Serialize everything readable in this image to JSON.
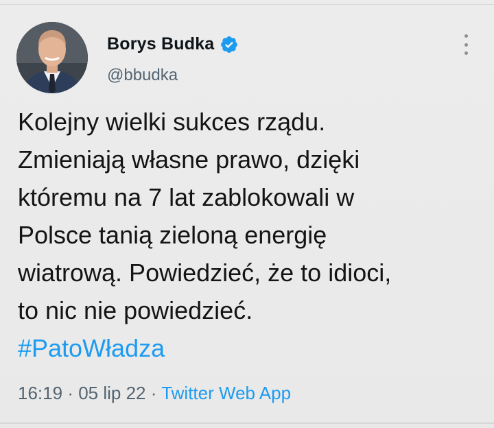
{
  "tweet": {
    "author_name": "Borys Budka",
    "author_handle": "@bbudka",
    "lines": [
      "Kolejny wielki sukces rządu.",
      "Zmieniają własne prawo, dzięki",
      "któremu na 7 lat zablokowali w",
      "Polsce tanią zieloną energię",
      "wiatrową. Powiedzieć, że to idioci,",
      "to nic nie powiedzieć."
    ],
    "hashtag": "#PatoWładza",
    "time": "16:19",
    "date": "05 lip 22",
    "source": "Twitter Web App",
    "separator": "·"
  },
  "colors": {
    "accent": "#1d9bf0",
    "secondary_text": "#536471",
    "background": "#e9e9e9"
  },
  "icons": {
    "verified": "verified-badge-icon",
    "more": "more-options-icon"
  }
}
